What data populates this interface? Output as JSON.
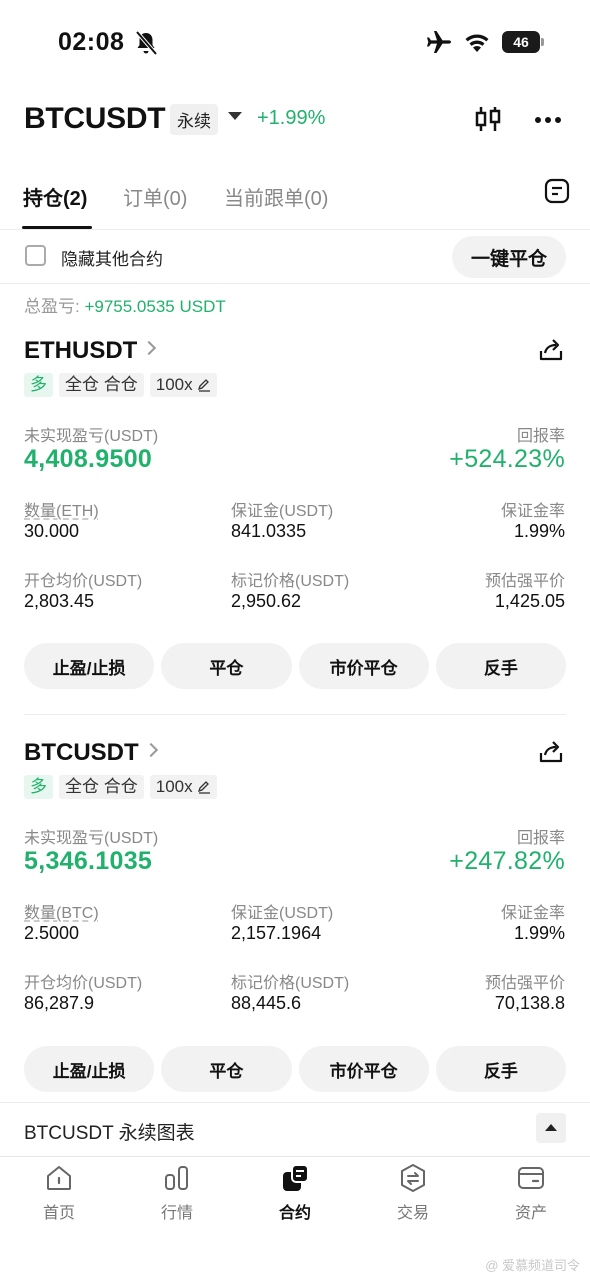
{
  "status_bar": {
    "time": "02:08",
    "battery": "46"
  },
  "header": {
    "symbol": "BTCUSDT",
    "contract_type": "永续",
    "change": "+1.99%"
  },
  "tabs": [
    {
      "label": "持仓(2)",
      "active": true
    },
    {
      "label": "订单(0)",
      "active": false
    },
    {
      "label": "当前跟单(0)",
      "active": false
    }
  ],
  "filter": {
    "hide_label": "隐藏其他合约",
    "close_all": "一键平仓"
  },
  "summary": {
    "total_pnl_label": "总盈亏: ",
    "total_pnl_value": "+9755.0535 USDT"
  },
  "labels": {
    "unrealized_pnl": "未实现盈亏(USDT)",
    "roe": "回报率",
    "margin": "保证金(USDT)",
    "margin_ratio": "保证金率",
    "entry_price": "开仓均价(USDT)",
    "mark_price": "标记价格(USDT)",
    "liq_price": "预估强平价"
  },
  "positions": [
    {
      "symbol": "ETHUSDT",
      "side": "多",
      "margin_mode": "全仓 合仓",
      "leverage": "100x",
      "unrealized_pnl": "4,408.9500",
      "roe": "+524.23%",
      "qty_label": "数量(ETH)",
      "qty": "30.000",
      "margin": "841.0335",
      "margin_ratio": "1.99%",
      "entry_price": "2,803.45",
      "mark_price": "2,950.62",
      "liq_price": "1,425.05"
    },
    {
      "symbol": "BTCUSDT",
      "side": "多",
      "margin_mode": "全仓 合仓",
      "leverage": "100x",
      "unrealized_pnl": "5,346.1035",
      "roe": "+247.82%",
      "qty_label": "数量(BTC)",
      "qty": "2.5000",
      "margin": "2,157.1964",
      "margin_ratio": "1.99%",
      "entry_price": "86,287.9",
      "mark_price": "88,445.6",
      "liq_price": "70,138.8"
    }
  ],
  "actions": [
    "止盈/止损",
    "平仓",
    "市价平仓",
    "反手"
  ],
  "chart_bar": {
    "label": "BTCUSDT 永续图表"
  },
  "nav": [
    {
      "label": "首页",
      "icon": "home-icon",
      "active": false
    },
    {
      "label": "行情",
      "icon": "market-icon",
      "active": false
    },
    {
      "label": "合约",
      "icon": "futures-icon",
      "active": true
    },
    {
      "label": "交易",
      "icon": "trade-icon",
      "active": false
    },
    {
      "label": "资产",
      "icon": "wallet-icon",
      "active": false
    }
  ],
  "watermark": "@ 爱慕频道司令",
  "colors": {
    "green": "#20b26c",
    "text": "#111111",
    "muted": "#888888"
  }
}
